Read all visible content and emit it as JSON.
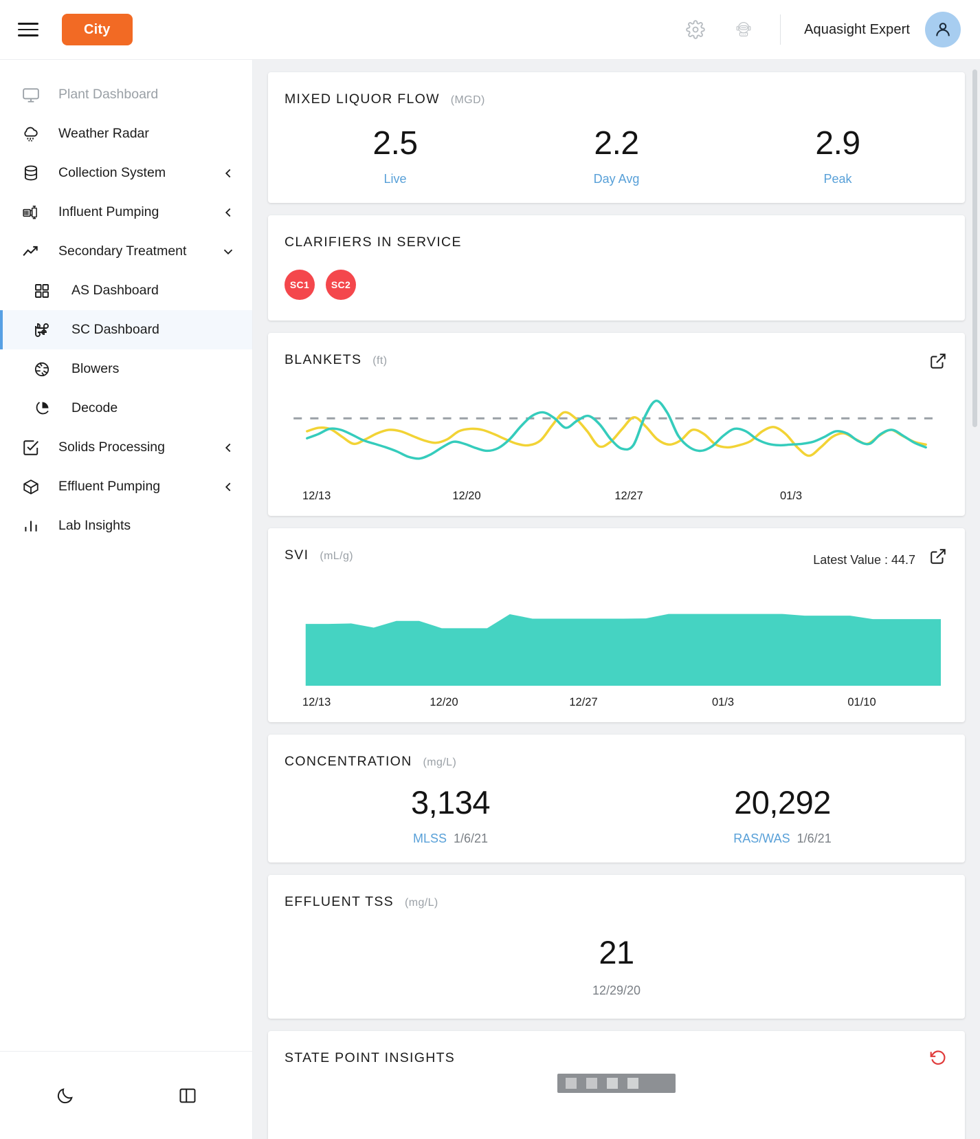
{
  "header": {
    "menu_icon": "hamburger-icon",
    "city_button": "City",
    "settings_icon": "gear-icon",
    "support_icon": "headset-bot-icon",
    "user_name": "Aquasight Expert",
    "avatar_icon": "user-avatar-icon"
  },
  "sidebar": {
    "items": [
      {
        "label": "Plant Dashboard",
        "icon": "monitor-icon",
        "muted": true,
        "chevron": "",
        "sub": false,
        "active": false
      },
      {
        "label": "Weather Radar",
        "icon": "rain-cloud-icon",
        "muted": false,
        "chevron": "",
        "sub": false,
        "active": false
      },
      {
        "label": "Collection System",
        "icon": "database-icon",
        "muted": false,
        "chevron": "left",
        "sub": false,
        "active": false
      },
      {
        "label": "Influent Pumping",
        "icon": "pump-icon",
        "muted": false,
        "chevron": "left",
        "sub": false,
        "active": false
      },
      {
        "label": "Secondary Treatment",
        "icon": "trend-up-icon",
        "muted": false,
        "chevron": "down",
        "sub": false,
        "active": false
      },
      {
        "label": "AS Dashboard",
        "icon": "grid-icon",
        "muted": false,
        "chevron": "",
        "sub": true,
        "active": false
      },
      {
        "label": "SC Dashboard",
        "icon": "command-icon",
        "muted": false,
        "chevron": "",
        "sub": true,
        "active": true
      },
      {
        "label": "Blowers",
        "icon": "aperture-icon",
        "muted": false,
        "chevron": "",
        "sub": true,
        "active": false
      },
      {
        "label": "Decode",
        "icon": "pie-chart-icon",
        "muted": false,
        "chevron": "",
        "sub": true,
        "active": false
      },
      {
        "label": "Solids Processing",
        "icon": "check-square-icon",
        "muted": false,
        "chevron": "left",
        "sub": false,
        "active": false
      },
      {
        "label": "Effluent Pumping",
        "icon": "package-icon",
        "muted": false,
        "chevron": "left",
        "sub": false,
        "active": false
      },
      {
        "label": "Lab Insights",
        "icon": "bar-chart-icon",
        "muted": false,
        "chevron": "",
        "sub": false,
        "active": false
      }
    ],
    "footer": {
      "dark_mode_icon": "moon-icon",
      "layout_icon": "sidebar-panel-icon"
    }
  },
  "cards": {
    "mixed_liquor_flow": {
      "title": "MIXED LIQUOR FLOW",
      "unit": "(MGD)",
      "stats": [
        {
          "value": "2.5",
          "label": "Live"
        },
        {
          "value": "2.2",
          "label": "Day Avg"
        },
        {
          "value": "2.9",
          "label": "Peak"
        }
      ]
    },
    "clarifiers": {
      "title": "CLARIFIERS IN SERVICE",
      "chips": [
        "SC1",
        "SC2"
      ],
      "chip_color": "#f4474c"
    },
    "blankets": {
      "title": "BLANKETS",
      "unit": "(ft)",
      "expand_icon": "external-link-icon"
    },
    "svi": {
      "title": "SVI",
      "unit": "(mL/g)",
      "latest_label": "Latest Value : 44.7",
      "expand_icon": "external-link-icon"
    },
    "concentration": {
      "title": "CONCENTRATION",
      "unit": "(mg/L)",
      "stats": [
        {
          "value": "3,134",
          "key": "MLSS",
          "date": "1/6/21"
        },
        {
          "value": "20,292",
          "key": "RAS/WAS",
          "date": "1/6/21"
        }
      ]
    },
    "effluent_tss": {
      "title": "EFFLUENT TSS",
      "unit": "(mg/L)",
      "value": "21",
      "date": "12/29/20"
    },
    "state_point": {
      "title": "STATE POINT INSIGHTS",
      "reload_icon": "reload-icon"
    }
  },
  "chart_data": [
    {
      "id": "blankets",
      "type": "line",
      "title": "BLANKETS",
      "ylabel": "ft",
      "xlabel": "",
      "tick_labels": [
        "12/13",
        "12/20",
        "12/27",
        "01/3"
      ],
      "grid": false,
      "legend": "none",
      "threshold_line": 1.55,
      "ylim": [
        0,
        2.4
      ],
      "series": [
        {
          "name": "SC1",
          "color": "#f2d335",
          "values": [
            1.18,
            1.28,
            1.24,
            1.02,
            0.82,
            0.95,
            1.12,
            1.22,
            1.18,
            1.05,
            0.92,
            0.85,
            0.95,
            1.18,
            1.25,
            1.22,
            1.1,
            0.95,
            0.82,
            0.78,
            0.92,
            1.35,
            1.72,
            1.55,
            1.18,
            0.75,
            0.88,
            1.25,
            1.58,
            1.32,
            0.95,
            0.8,
            0.92,
            1.22,
            1.1,
            0.8,
            0.72,
            0.78,
            0.9,
            1.18,
            1.3,
            1.1,
            0.72,
            0.48,
            0.72,
            1.02,
            1.12,
            0.95,
            0.82,
            1.05,
            1.22,
            1.05,
            0.88,
            0.8
          ]
        },
        {
          "name": "SC2",
          "color": "#35ccbc",
          "values": [
            0.98,
            1.1,
            1.25,
            1.22,
            1.08,
            0.92,
            0.82,
            0.72,
            0.6,
            0.45,
            0.4,
            0.52,
            0.72,
            0.88,
            0.82,
            0.7,
            0.62,
            0.7,
            0.95,
            1.32,
            1.62,
            1.72,
            1.55,
            1.28,
            1.48,
            1.62,
            1.38,
            0.95,
            0.68,
            0.78,
            1.58,
            2.05,
            1.72,
            1.05,
            0.72,
            0.62,
            0.75,
            1.05,
            1.25,
            1.18,
            0.95,
            0.82,
            0.78,
            0.8,
            0.82,
            0.88,
            1.02,
            1.18,
            1.12,
            0.9,
            0.82,
            1.1,
            1.22,
            1.05,
            0.85,
            0.72
          ]
        }
      ]
    },
    {
      "id": "svi",
      "type": "area",
      "title": "SVI",
      "ylabel": "mL/g",
      "xlabel": "",
      "tick_labels": [
        "12/13",
        "12/20",
        "12/27",
        "01/3",
        "01/10"
      ],
      "grid": false,
      "legend": "none",
      "color": "#45d3c2",
      "latest_value": 44.7,
      "ylim": [
        0,
        60
      ],
      "x": [
        "12/13",
        "12/14",
        "12/15",
        "12/16",
        "12/17",
        "12/18",
        "12/19",
        "12/20",
        "12/21",
        "12/22",
        "12/23",
        "12/24",
        "12/25",
        "12/26",
        "12/27",
        "12/28",
        "12/29",
        "12/30",
        "12/31",
        "01/1",
        "01/2",
        "01/3",
        "01/4",
        "01/5",
        "01/6",
        "01/7",
        "01/8",
        "01/9",
        "01/10"
      ],
      "values": [
        41.5,
        41.5,
        41.8,
        39.0,
        43.5,
        43.5,
        38.6,
        38.6,
        38.6,
        48.0,
        45.0,
        45.0,
        45.0,
        45.0,
        45.0,
        45.2,
        48.2,
        48.2,
        48.2,
        48.2,
        48.2,
        48.2,
        47.0,
        47.0,
        47.0,
        44.7,
        44.7,
        44.7,
        44.7
      ]
    }
  ]
}
